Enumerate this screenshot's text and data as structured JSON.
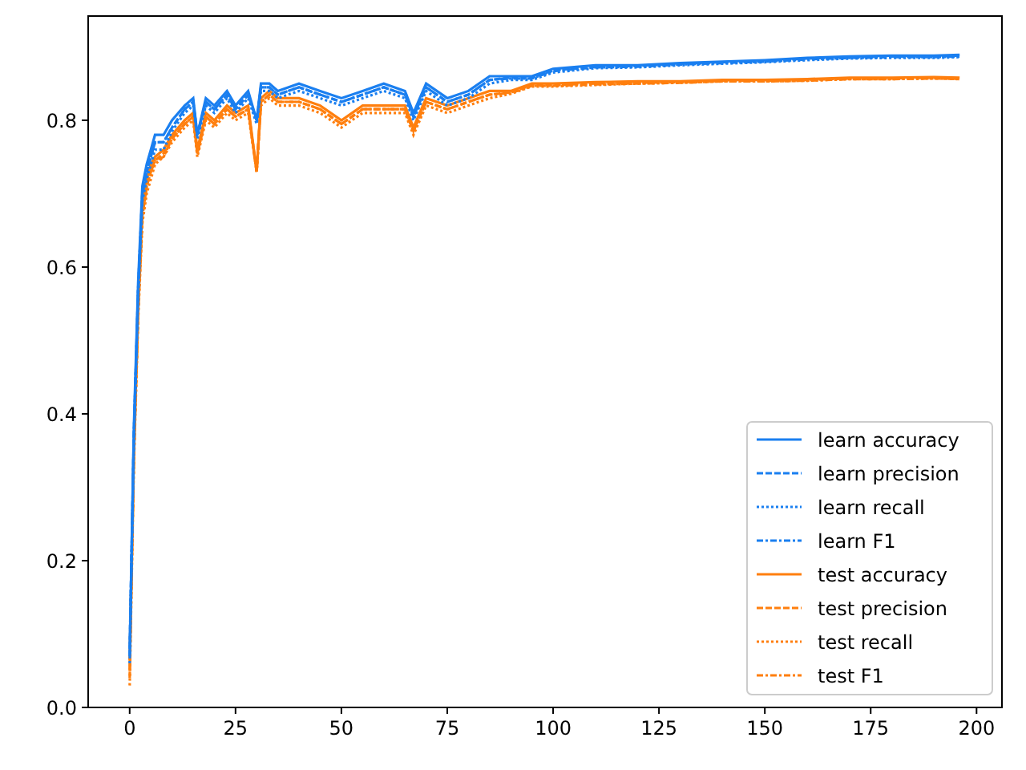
{
  "chart_data": {
    "type": "line",
    "legend": "lower right",
    "xlim": [
      -9.8,
      206
    ],
    "ylim": [
      0,
      0.942
    ],
    "xticks": [
      0,
      25,
      50,
      75,
      100,
      125,
      150,
      175,
      200
    ],
    "yticks": [
      {
        "value": 0,
        "label": "0.0"
      },
      {
        "value": 0.2,
        "label": "0.2"
      },
      {
        "value": 0.4,
        "label": "0.4"
      },
      {
        "value": 0.6,
        "label": "0.6"
      },
      {
        "value": 0.8,
        "label": "0.8"
      }
    ],
    "x": [
      0,
      1,
      2,
      3,
      4,
      5,
      6,
      8,
      10,
      13,
      15,
      16,
      18,
      20,
      23,
      25,
      28,
      30,
      31,
      33,
      35,
      40,
      45,
      50,
      55,
      60,
      65,
      67,
      70,
      75,
      80,
      85,
      90,
      95,
      100,
      110,
      120,
      130,
      140,
      150,
      160,
      170,
      180,
      190,
      196
    ],
    "series": [
      {
        "name": "learn accuracy",
        "color": "#1a7ff0",
        "line_style": "solid",
        "values": [
          0.07,
          0.38,
          0.58,
          0.71,
          0.74,
          0.76,
          0.78,
          0.78,
          0.8,
          0.82,
          0.83,
          0.78,
          0.83,
          0.82,
          0.84,
          0.82,
          0.84,
          0.8,
          0.85,
          0.85,
          0.84,
          0.85,
          0.84,
          0.83,
          0.84,
          0.85,
          0.84,
          0.81,
          0.85,
          0.83,
          0.84,
          0.86,
          0.86,
          0.86,
          0.87,
          0.875,
          0.875,
          0.878,
          0.88,
          0.882,
          0.885,
          0.887,
          0.888,
          0.888,
          0.889
        ]
      },
      {
        "name": "learn precision",
        "color": "#1a7ff0",
        "line_style": "dashed",
        "values": [
          0.08,
          0.37,
          0.57,
          0.7,
          0.73,
          0.75,
          0.77,
          0.77,
          0.79,
          0.815,
          0.825,
          0.78,
          0.825,
          0.815,
          0.835,
          0.815,
          0.835,
          0.8,
          0.845,
          0.845,
          0.835,
          0.845,
          0.835,
          0.825,
          0.835,
          0.845,
          0.835,
          0.805,
          0.845,
          0.825,
          0.835,
          0.855,
          0.858,
          0.858,
          0.868,
          0.873,
          0.874,
          0.877,
          0.879,
          0.881,
          0.884,
          0.886,
          0.887,
          0.887,
          0.888
        ]
      },
      {
        "name": "learn recall",
        "color": "#1a7ff0",
        "line_style": "dotted",
        "values": [
          0.06,
          0.36,
          0.56,
          0.69,
          0.72,
          0.74,
          0.76,
          0.76,
          0.785,
          0.81,
          0.82,
          0.775,
          0.82,
          0.81,
          0.83,
          0.81,
          0.83,
          0.795,
          0.84,
          0.84,
          0.83,
          0.84,
          0.83,
          0.82,
          0.83,
          0.84,
          0.83,
          0.8,
          0.84,
          0.82,
          0.83,
          0.85,
          0.855,
          0.855,
          0.865,
          0.871,
          0.872,
          0.875,
          0.877,
          0.879,
          0.882,
          0.884,
          0.885,
          0.885,
          0.886
        ]
      },
      {
        "name": "learn F1",
        "color": "#1a7ff0",
        "line_style": "dashdot",
        "values": [
          0.07,
          0.37,
          0.57,
          0.7,
          0.73,
          0.75,
          0.77,
          0.77,
          0.79,
          0.815,
          0.825,
          0.78,
          0.825,
          0.815,
          0.835,
          0.815,
          0.835,
          0.8,
          0.845,
          0.845,
          0.835,
          0.845,
          0.835,
          0.825,
          0.835,
          0.845,
          0.835,
          0.805,
          0.845,
          0.825,
          0.835,
          0.855,
          0.857,
          0.857,
          0.867,
          0.872,
          0.873,
          0.876,
          0.878,
          0.88,
          0.883,
          0.885,
          0.886,
          0.886,
          0.887
        ]
      },
      {
        "name": "test accuracy",
        "color": "#ff7f0e",
        "line_style": "solid",
        "values": [
          0.05,
          0.35,
          0.55,
          0.68,
          0.72,
          0.74,
          0.75,
          0.76,
          0.78,
          0.8,
          0.81,
          0.76,
          0.81,
          0.8,
          0.82,
          0.81,
          0.82,
          0.73,
          0.83,
          0.84,
          0.83,
          0.83,
          0.82,
          0.8,
          0.82,
          0.82,
          0.82,
          0.79,
          0.83,
          0.82,
          0.83,
          0.84,
          0.84,
          0.85,
          0.85,
          0.852,
          0.853,
          0.853,
          0.855,
          0.855,
          0.856,
          0.858,
          0.858,
          0.859,
          0.858
        ]
      },
      {
        "name": "test precision",
        "color": "#ff7f0e",
        "line_style": "dashed",
        "values": [
          0.04,
          0.34,
          0.54,
          0.67,
          0.71,
          0.73,
          0.745,
          0.755,
          0.775,
          0.795,
          0.805,
          0.755,
          0.805,
          0.795,
          0.815,
          0.805,
          0.815,
          0.73,
          0.825,
          0.835,
          0.825,
          0.825,
          0.815,
          0.795,
          0.815,
          0.815,
          0.815,
          0.785,
          0.825,
          0.815,
          0.825,
          0.835,
          0.838,
          0.848,
          0.848,
          0.85,
          0.851,
          0.852,
          0.854,
          0.854,
          0.855,
          0.857,
          0.857,
          0.858,
          0.857
        ]
      },
      {
        "name": "test recall",
        "color": "#ff7f0e",
        "line_style": "dotted",
        "values": [
          0.03,
          0.33,
          0.53,
          0.66,
          0.7,
          0.72,
          0.74,
          0.75,
          0.77,
          0.79,
          0.8,
          0.75,
          0.8,
          0.79,
          0.81,
          0.8,
          0.81,
          0.73,
          0.82,
          0.83,
          0.82,
          0.82,
          0.81,
          0.79,
          0.81,
          0.81,
          0.81,
          0.78,
          0.82,
          0.81,
          0.82,
          0.83,
          0.836,
          0.846,
          0.846,
          0.848,
          0.85,
          0.851,
          0.853,
          0.853,
          0.854,
          0.856,
          0.856,
          0.857,
          0.856
        ]
      },
      {
        "name": "test F1",
        "color": "#ff7f0e",
        "line_style": "dashdot",
        "values": [
          0.065,
          0.34,
          0.54,
          0.67,
          0.71,
          0.73,
          0.745,
          0.75,
          0.775,
          0.795,
          0.805,
          0.755,
          0.805,
          0.795,
          0.815,
          0.805,
          0.815,
          0.73,
          0.825,
          0.835,
          0.825,
          0.825,
          0.815,
          0.795,
          0.815,
          0.815,
          0.815,
          0.785,
          0.825,
          0.815,
          0.825,
          0.835,
          0.837,
          0.847,
          0.847,
          0.849,
          0.85,
          0.851,
          0.853,
          0.853,
          0.854,
          0.856,
          0.856,
          0.857,
          0.856
        ]
      }
    ]
  }
}
